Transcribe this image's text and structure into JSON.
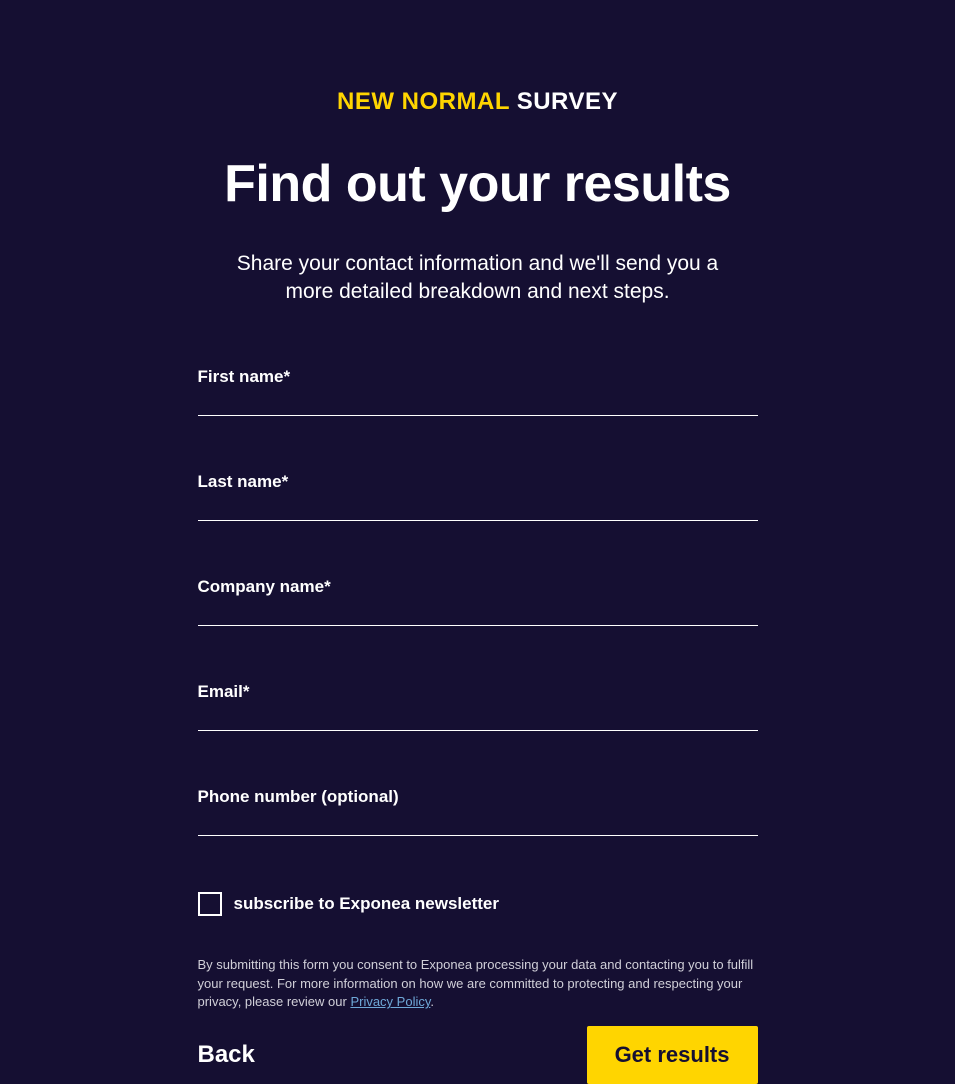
{
  "header": {
    "label_highlight": "NEW NORMAL",
    "label_rest": " SURVEY"
  },
  "title": "Find out your results",
  "description": "Share your contact information and we'll send you a more detailed breakdown and next steps.",
  "form": {
    "first_name": {
      "label": "First name*",
      "value": ""
    },
    "last_name": {
      "label": "Last name*",
      "value": ""
    },
    "company_name": {
      "label": "Company name*",
      "value": ""
    },
    "email": {
      "label": "Email*",
      "value": ""
    },
    "phone": {
      "label": "Phone number (optional)",
      "value": ""
    },
    "newsletter": {
      "label": "subscribe to Exponea newsletter",
      "checked": false
    }
  },
  "consent": {
    "text_before": "By submitting this form you consent to Exponea processing your data and contacting you to fulfill your request. For more information on how we are committed to protecting and respecting your privacy, please review our ",
    "link_text": "Privacy Policy",
    "text_after": "."
  },
  "actions": {
    "back": "Back",
    "submit": "Get results"
  }
}
